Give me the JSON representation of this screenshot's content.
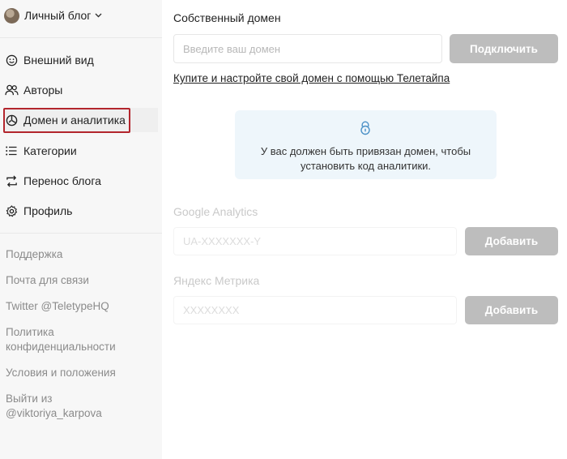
{
  "sidebar": {
    "blog_name": "Личный блог",
    "items": [
      {
        "label": "Внешний вид",
        "icon": "smile-icon"
      },
      {
        "label": "Авторы",
        "icon": "users-icon"
      },
      {
        "label": "Домен и аналитика",
        "icon": "analytics-icon"
      },
      {
        "label": "Категории",
        "icon": "list-icon"
      },
      {
        "label": "Перенос блога",
        "icon": "transfer-icon"
      },
      {
        "label": "Профиль",
        "icon": "gear-icon"
      }
    ],
    "active_item": "Домен и аналитика",
    "footer_links": [
      "Поддержка",
      "Почта для связи",
      "Twitter @TeletypeHQ",
      "Политика конфиденциальности",
      "Условия и положения",
      "Выйти из @viktoriya_karpova"
    ]
  },
  "domain": {
    "title": "Собственный домен",
    "placeholder": "Введите ваш домен",
    "connect_label": "Подключить",
    "buy_link": "Купите и настройте свой домен с помощью Телетайпа"
  },
  "notice": {
    "icon": "lock-icon",
    "text": "У вас должен быть привязан домен, чтобы установить код аналитики."
  },
  "google": {
    "title": "Google Analytics",
    "placeholder": "UA-XXXXXXX-Y",
    "add_label": "Добавить"
  },
  "yandex": {
    "title": "Яндекс Метрика",
    "placeholder": "XXXXXXXX",
    "add_label": "Добавить"
  },
  "colors": {
    "highlight": "#b3262d",
    "notice_bg": "#eef6fb",
    "button_bg": "#bdbdbd",
    "lock_icon": "#4a90c6"
  }
}
